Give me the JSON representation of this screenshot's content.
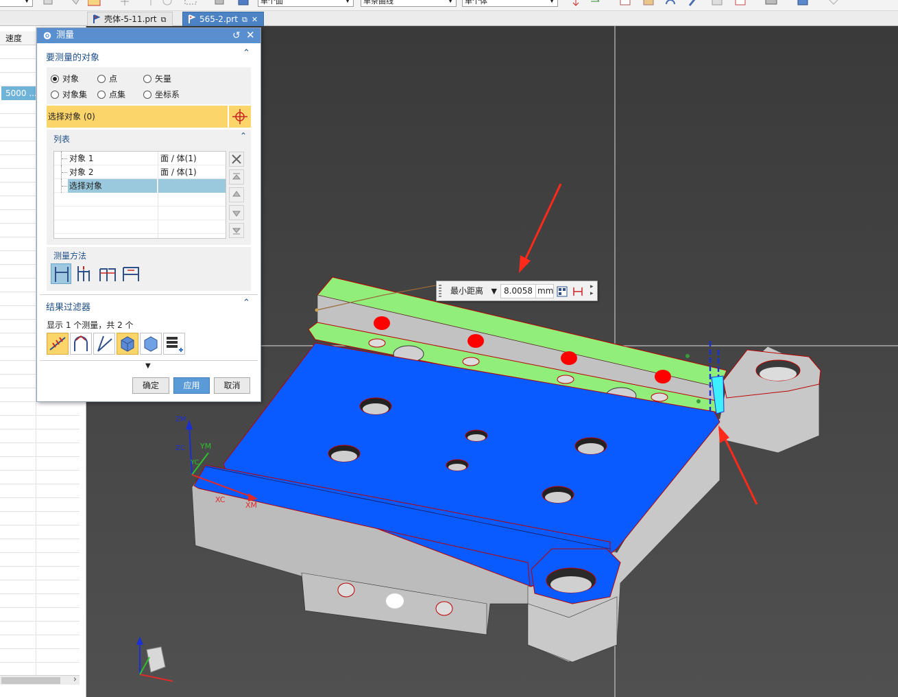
{
  "tabs": [
    {
      "label": "壳体-5-11.prt",
      "active": false
    },
    {
      "label": "565-2.prt",
      "active": true
    }
  ],
  "toolbar": {
    "combo1": "单个面",
    "combo2": "单条曲线",
    "combo3": "单个体"
  },
  "sheet": {
    "header": "速度",
    "cell_value": "5000 ..."
  },
  "dialog": {
    "title": "测量",
    "section_objects": "要测量的对象",
    "radio_options": [
      "对象",
      "点",
      "矢量",
      "对象集",
      "点集",
      "坐标系"
    ],
    "selected_radio": "对象",
    "select_prompt": "选择对象 (0)",
    "list_header": "列表",
    "list_rows": [
      {
        "name": "对象 1",
        "type": "面 / 体(1)"
      },
      {
        "name": "对象 2",
        "type": "面 / 体(1)"
      },
      {
        "name": "选择对象",
        "type": ""
      }
    ],
    "method_header": "测量方法",
    "filter_header": "结果过滤器",
    "filter_info": "显示 1 个测量，共 2 个",
    "ok": "确定",
    "apply": "应用",
    "cancel": "取消"
  },
  "measure_popup": {
    "mode": "最小距离",
    "value": "8.0058",
    "unit": "mm"
  },
  "triad": {
    "zm": "ZM",
    "zc": "ZC",
    "ym": "YM",
    "yc": "YC",
    "xc": "XC",
    "xm": "XM"
  },
  "colors": {
    "face_blue": "#0a5bff",
    "face_green": "#90ef78",
    "body_grey": "#c4c4c4",
    "hole_red": "#ff0000",
    "dialog_title": "#5a8fcf",
    "highlight_yellow": "#fcd56a"
  }
}
